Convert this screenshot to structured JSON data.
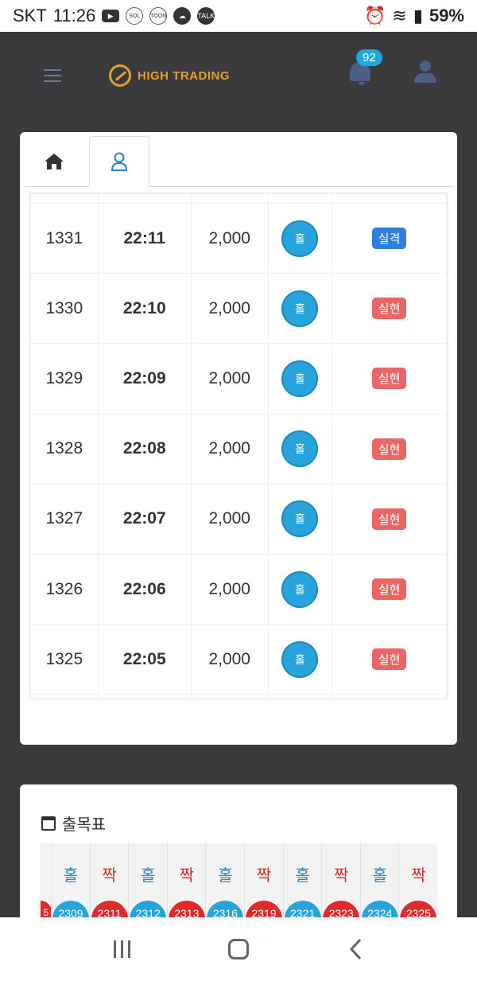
{
  "status_bar": {
    "carrier": "SKT",
    "time": "11:26",
    "battery": "59%",
    "icons": [
      "youtube-icon",
      "sol-icon",
      "toon-icon",
      "cloud-icon",
      "talk-icon",
      "alarm-icon",
      "wifi-icon",
      "signal-icon"
    ]
  },
  "header": {
    "logo_text": "HIGH TRADING",
    "notification_count": "92"
  },
  "tabs": [
    {
      "name": "home",
      "icon": "home-icon",
      "active": false
    },
    {
      "name": "profile",
      "icon": "person-icon",
      "active": true
    }
  ],
  "results_table": {
    "rows": [
      {
        "round": "1331",
        "time": "22:11",
        "amount": "2,000",
        "pick": "홀",
        "result": "실격",
        "result_type": "fail"
      },
      {
        "round": "1330",
        "time": "22:10",
        "amount": "2,000",
        "pick": "홀",
        "result": "실현",
        "result_type": "ok"
      },
      {
        "round": "1329",
        "time": "22:09",
        "amount": "2,000",
        "pick": "홀",
        "result": "실현",
        "result_type": "ok"
      },
      {
        "round": "1328",
        "time": "22:08",
        "amount": "2,000",
        "pick": "홀",
        "result": "실현",
        "result_type": "ok"
      },
      {
        "round": "1327",
        "time": "22:07",
        "amount": "2,000",
        "pick": "홀",
        "result": "실현",
        "result_type": "ok"
      },
      {
        "round": "1326",
        "time": "22:06",
        "amount": "2,000",
        "pick": "홀",
        "result": "실현",
        "result_type": "ok"
      },
      {
        "round": "1325",
        "time": "22:05",
        "amount": "2,000",
        "pick": "홀",
        "result": "실현",
        "result_type": "ok"
      }
    ]
  },
  "chart_card": {
    "title": "출목표",
    "columns": [
      {
        "label": "",
        "ball": "5",
        "kind": "even"
      },
      {
        "label": "홀",
        "ball": "2309",
        "kind": "odd"
      },
      {
        "label": "짝",
        "ball": "2311",
        "kind": "even"
      },
      {
        "label": "홀",
        "ball": "2312",
        "kind": "odd"
      },
      {
        "label": "짝",
        "ball": "2313",
        "kind": "even"
      },
      {
        "label": "홀",
        "ball": "2316",
        "kind": "odd"
      },
      {
        "label": "짝",
        "ball": "2319",
        "kind": "even"
      },
      {
        "label": "홀",
        "ball": "2321",
        "kind": "odd"
      },
      {
        "label": "짝",
        "ball": "2323",
        "kind": "even"
      },
      {
        "label": "홀",
        "ball": "2324",
        "kind": "odd"
      },
      {
        "label": "짝",
        "ball": "2325",
        "kind": "even"
      }
    ]
  },
  "colors": {
    "background": "#3a3a3c",
    "odd_blue": "#27a4dc",
    "even_red": "#e02b2b",
    "fail_badge": "#2f7fe0",
    "ok_badge": "#e96566",
    "logo_gold": "#e3a032"
  }
}
